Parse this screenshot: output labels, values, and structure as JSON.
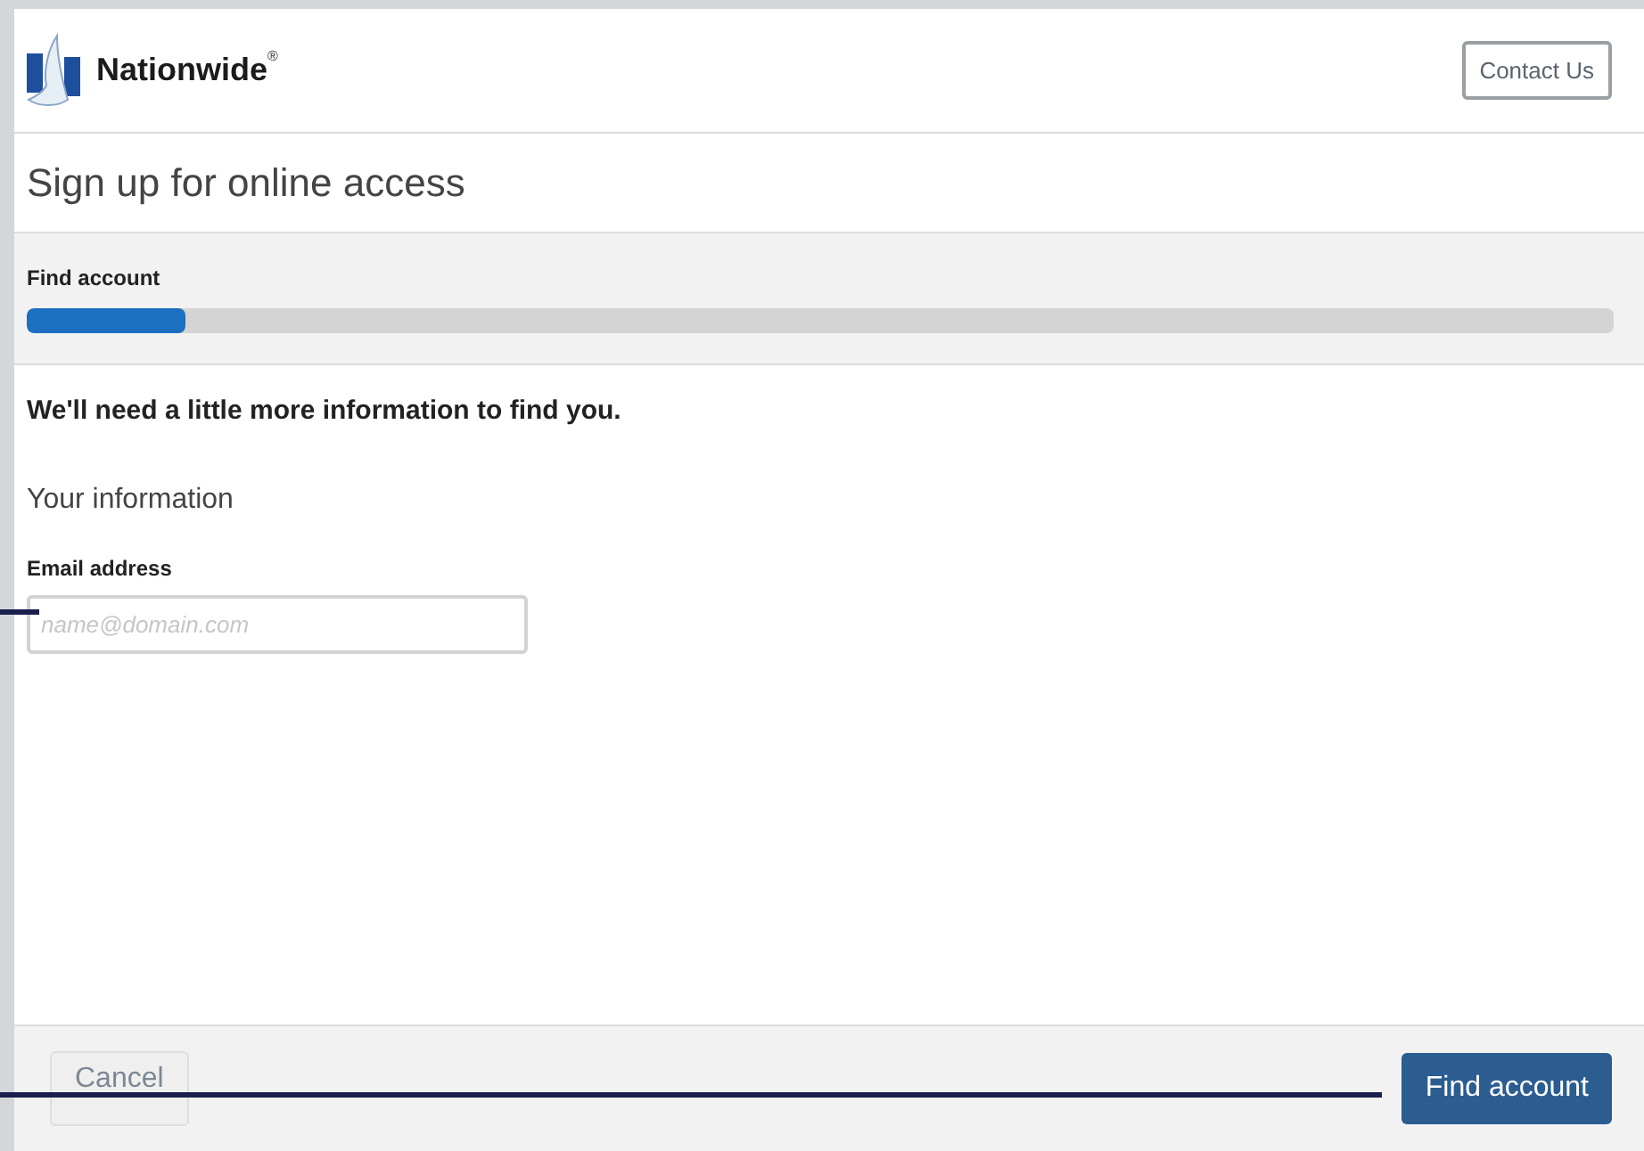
{
  "header": {
    "brand": "Nationwide",
    "brand_mark": "®",
    "contact_button": "Contact Us"
  },
  "title": "Sign up for online access",
  "progress": {
    "label": "Find account",
    "level": 0.1
  },
  "form": {
    "heading": "We'll need a little more information to find you.",
    "section": "Your information",
    "field": {
      "label": "Email address",
      "placeholder": "name@domain.com"
    }
  },
  "footer": {
    "buttons": [
      {
        "label": "Cancel",
        "kind": "secondary",
        "disabled": true
      },
      {
        "label": "Find account",
        "kind": "primary",
        "disabled": false
      }
    ]
  }
}
